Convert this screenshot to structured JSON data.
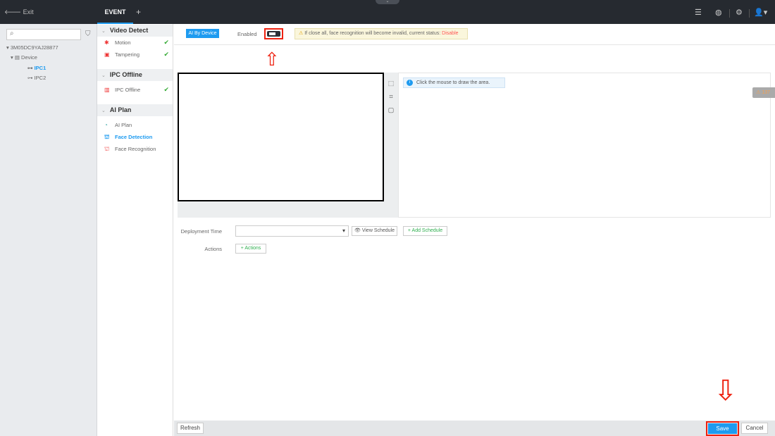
{
  "topbar": {
    "exit_label": "Exit",
    "tab_label": "EVENT",
    "add_tab": "+",
    "icons": [
      "list-icon",
      "globe-icon",
      "gear-icon",
      "user-icon"
    ]
  },
  "tree": {
    "search_placeholder": "",
    "root": "3M05DC9YAJ28877",
    "device": "Device",
    "channels": [
      "IPC1",
      "IPC2"
    ],
    "selected": "IPC1"
  },
  "menu": {
    "groups": [
      {
        "title": "Video Detect",
        "items": [
          {
            "label": "Motion",
            "checked": true
          },
          {
            "label": "Tampering",
            "checked": true
          }
        ]
      },
      {
        "title": "IPC Offline",
        "items": [
          {
            "label": "IPC Offline",
            "checked": true
          }
        ]
      },
      {
        "title": "AI Plan",
        "items": [
          {
            "label": "AI Plan",
            "checked": false
          },
          {
            "label": "Face Detection",
            "checked": false,
            "active": true
          },
          {
            "label": "Face Recognition",
            "checked": false
          }
        ]
      }
    ]
  },
  "main": {
    "ai_by_device": "AI By Device",
    "enabled_label": "Enabled",
    "enabled": false,
    "warning_text": "If close all, face recognition will become invalid, current status: ",
    "warning_status": "Disable",
    "info_text": "Click the mouse to draw the area.",
    "alert_count": "137",
    "deployment_label": "Deployment Time",
    "deployment_value": "",
    "view_schedule": "View Schedule",
    "add_schedule": "Add Schedule",
    "actions_label": "Actions",
    "actions_button": "Actions"
  },
  "footer": {
    "refresh": "Refresh",
    "save": "Save",
    "cancel": "Cancel"
  },
  "colors": {
    "accent": "#1e9bf0",
    "highlight": "#ee2211",
    "topbar": "#262a30"
  }
}
